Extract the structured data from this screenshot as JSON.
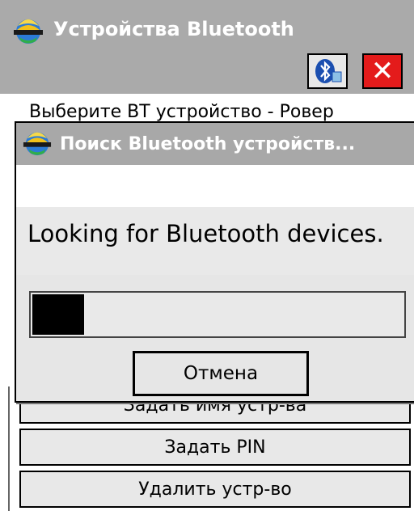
{
  "window": {
    "title": "Устройства Bluetooth",
    "prompt": "Выберите BT устройство - Ровер",
    "buttons": {
      "set_name": "Задать имя устр-ва",
      "set_pin": "Задать PIN",
      "delete_device": "Удалить устр-во"
    },
    "toolbar_icons": [
      "bluetooth-icon",
      "close-icon"
    ],
    "close_color": "#e41b1b"
  },
  "dialog": {
    "title": "Поиск Bluetooth устройств...",
    "message": "Looking for Bluetooth devices.",
    "progress": 0.14,
    "cancel_label": "Отмена"
  }
}
